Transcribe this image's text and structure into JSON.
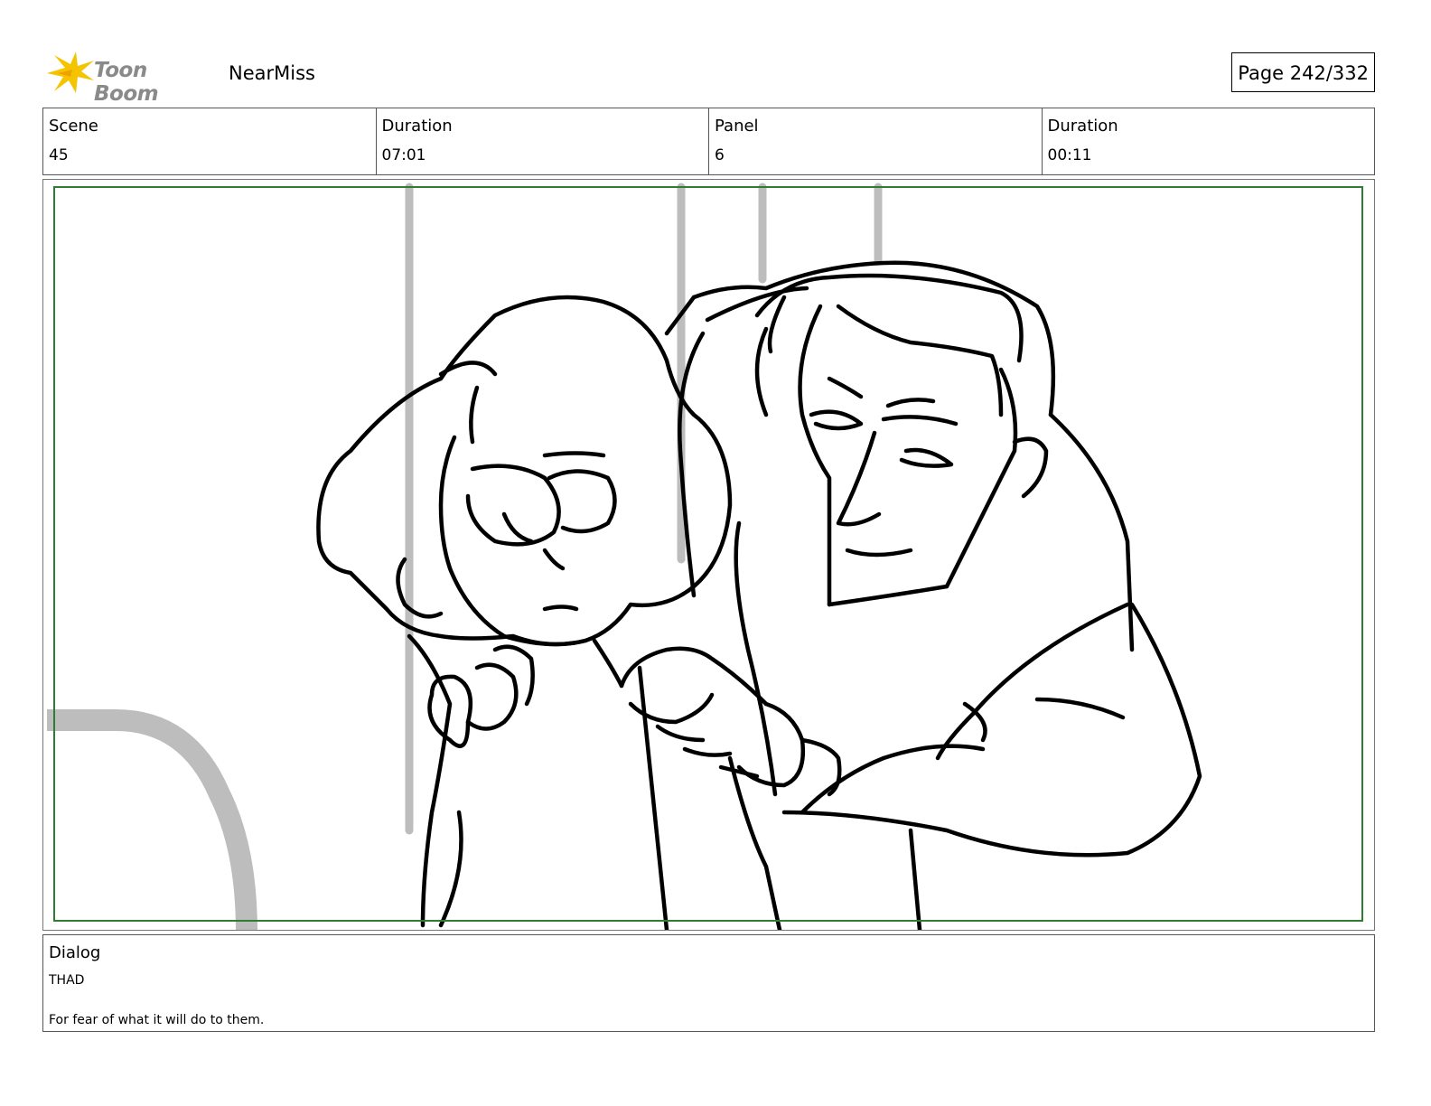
{
  "header": {
    "logo_text": "Toon Boom",
    "project_name": "NearMiss",
    "page_indicator": "Page 242/332"
  },
  "info": {
    "scene_label": "Scene",
    "scene_value": "45",
    "scene_duration_label": "Duration",
    "scene_duration_value": "07:01",
    "panel_label": "Panel",
    "panel_value": "6",
    "panel_duration_label": "Duration",
    "panel_duration_value": "00:11"
  },
  "dialog": {
    "label": "Dialog",
    "speaker": "THAD",
    "line": "For fear of what it will do to them."
  },
  "colors": {
    "safe_frame": "#2e7d32",
    "background_sketch": "#bdbdbd",
    "logo_star": "#f5c400"
  }
}
